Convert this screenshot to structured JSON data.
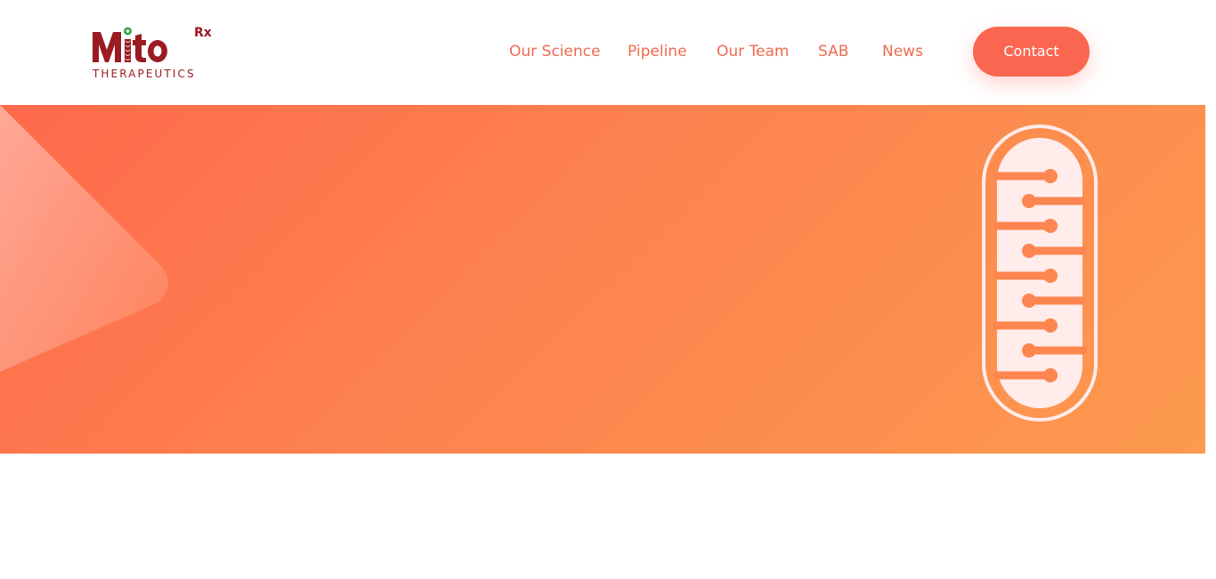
{
  "brand": {
    "logo_main": "Mito",
    "logo_superscript": "Rx",
    "logo_sub": "THERAPEUTICS",
    "colors": {
      "logo_red": "#9b1b22",
      "logo_green": "#3aa54a",
      "accent": "#fa6650",
      "nav_text": "#ee6a50"
    }
  },
  "nav": {
    "items": [
      {
        "label": "Our Science"
      },
      {
        "label": "Pipeline"
      },
      {
        "label": "Our Team"
      },
      {
        "label": "SAB"
      },
      {
        "label": "News"
      }
    ],
    "contact_label": "Contact"
  },
  "hero": {
    "gradient_start": "#ff6a4c",
    "gradient_end": "#fd9a4f",
    "icon": "mitochondria-icon",
    "decor": "rounded-triangle-shape"
  }
}
